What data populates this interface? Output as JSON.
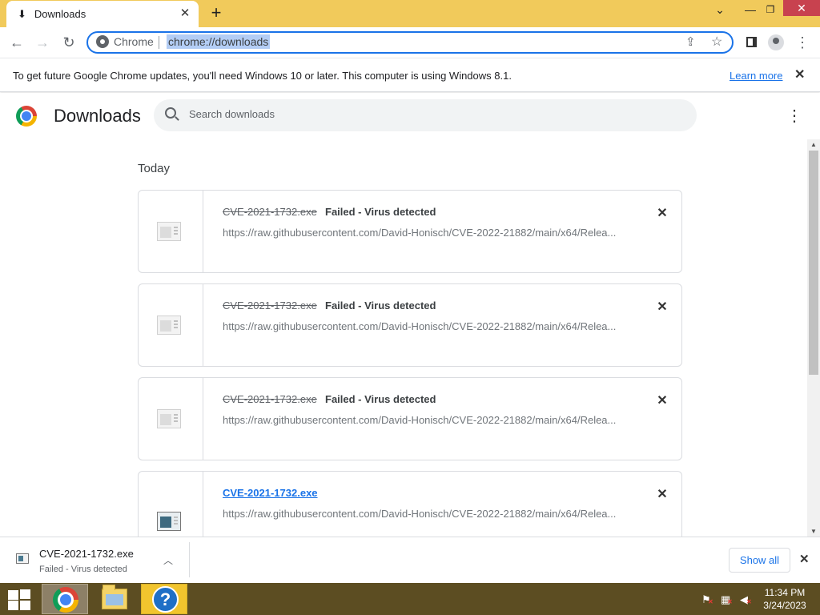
{
  "window": {
    "tab_title": "Downloads",
    "tab_close_glyph": "✕",
    "new_tab_glyph": "+",
    "controls": {
      "chevron": "⌄",
      "minimize": "—",
      "maximize": "❐",
      "close": "✕"
    }
  },
  "toolbar": {
    "back_glyph": "←",
    "forward_glyph": "→",
    "reload_glyph": "↻",
    "chip_label": "Chrome",
    "url": "chrome://downloads",
    "share_glyph": "⇪",
    "star_glyph": "☆",
    "menu_glyph": "⋮"
  },
  "infobar": {
    "message": "To get future Google Chrome updates, you'll need Windows 10 or later. This computer is using Windows 8.1.",
    "link": "Learn more",
    "close_glyph": "✕"
  },
  "downloads_page": {
    "title": "Downloads",
    "search_placeholder": "Search downloads",
    "menu_glyph": "⋮",
    "date_group": "Today",
    "items": [
      {
        "name": "CVE-2021-1732.exe",
        "status": "Failed - Virus detected",
        "url": "https://raw.githubusercontent.com/David-Honisch/CVE-2022-21882/main/x64/Relea...",
        "close_glyph": "✕"
      },
      {
        "name": "CVE-2021-1732.exe",
        "status": "Failed - Virus detected",
        "url": "https://raw.githubusercontent.com/David-Honisch/CVE-2022-21882/main/x64/Relea...",
        "close_glyph": "✕"
      },
      {
        "name": "CVE-2021-1732.exe",
        "status": "Failed - Virus detected",
        "url": "https://raw.githubusercontent.com/David-Honisch/CVE-2022-21882/main/x64/Relea...",
        "close_glyph": "✕"
      },
      {
        "name": "CVE-2021-1732.exe",
        "status": "",
        "url": "https://raw.githubusercontent.com/David-Honisch/CVE-2022-21882/main/x64/Relea...",
        "close_glyph": "✕"
      }
    ]
  },
  "scrollbar": {
    "up_glyph": "▲",
    "down_glyph": "▼"
  },
  "shelf": {
    "file_name": "CVE-2021-1732.exe",
    "status": "Failed - Virus detected",
    "chevron_glyph": "︿",
    "show_all": "Show all",
    "close_glyph": "✕"
  },
  "taskbar": {
    "help_glyph": "?",
    "tray": {
      "flag_glyph": "⚑",
      "network_glyph": "▦",
      "volume_glyph": "◀",
      "x_glyph": "✕"
    },
    "time": "11:34 PM",
    "date": "3/24/2023"
  },
  "colors": {
    "title_bar": "#f1ca5b",
    "accent": "#1a73e8",
    "taskbar": "#5c4d22",
    "close_button": "#c8424f"
  }
}
